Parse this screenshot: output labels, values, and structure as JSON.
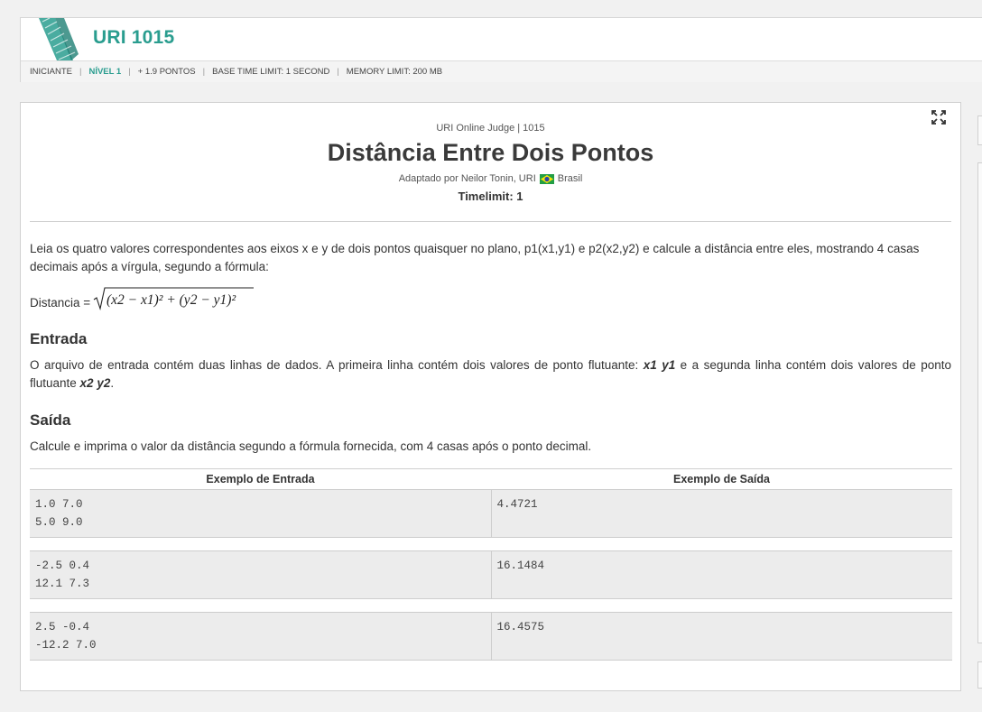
{
  "header": {
    "problem_code": "URI 1015",
    "meta": {
      "category": "INICIANTE",
      "level": "NÍVEL 1",
      "points": "+ 1.9 PONTOS",
      "time_limit": "BASE TIME LIMIT: 1 SECOND",
      "memory_limit": "MEMORY LIMIT: 200 MB"
    }
  },
  "problem": {
    "judge_line": "URI Online Judge | 1015",
    "title": "Distância Entre Dois Pontos",
    "author_prefix": "Adaptado por Neilor Tonin, URI",
    "country": "Brasil",
    "timelimit": "Timelimit: 1",
    "intro": "Leia os quatro valores correspondentes aos eixos x e y de dois pontos quaisquer no plano, p1(x1,y1) e p2(x2,y2) e calcule a distância entre eles, mostrando 4 casas decimais após a vírgula, segundo a fórmula:",
    "formula_label": "Distancia =",
    "formula": "(x2 − x1)² + (y2 − y1)²",
    "input_heading": "Entrada",
    "input_text_1": "O arquivo de entrada contém duas linhas de dados. A primeira linha contém dois valores de ponto flutuante: ",
    "input_var_1": "x1 y1",
    "input_text_2": " e a segunda linha contém dois valores de ponto flutuante ",
    "input_var_2": "x2 y2",
    "input_text_3": ".",
    "output_heading": "Saída",
    "output_text": "Calcule e imprima o valor da distância segundo a fórmula fornecida, com 4 casas após o ponto decimal."
  },
  "examples": {
    "input_header": "Exemplo de Entrada",
    "output_header": "Exemplo de Saída",
    "rows": [
      {
        "input": "1.0 7.0\n5.0 9.0",
        "output": "4.4721"
      },
      {
        "input": "-2.5 0.4\n12.1 7.3",
        "output": "16.1484"
      },
      {
        "input": "2.5 -0.4\n-12.2 7.0",
        "output": "16.4575"
      }
    ]
  },
  "colors": {
    "accent": "#2a9d8f",
    "page_bg": "#f1f1f1",
    "example_bg": "#ececec"
  },
  "icons": {
    "expand": "expand-icon",
    "flag": "brazil-flag-icon",
    "logo": "uri-logo-icon"
  }
}
